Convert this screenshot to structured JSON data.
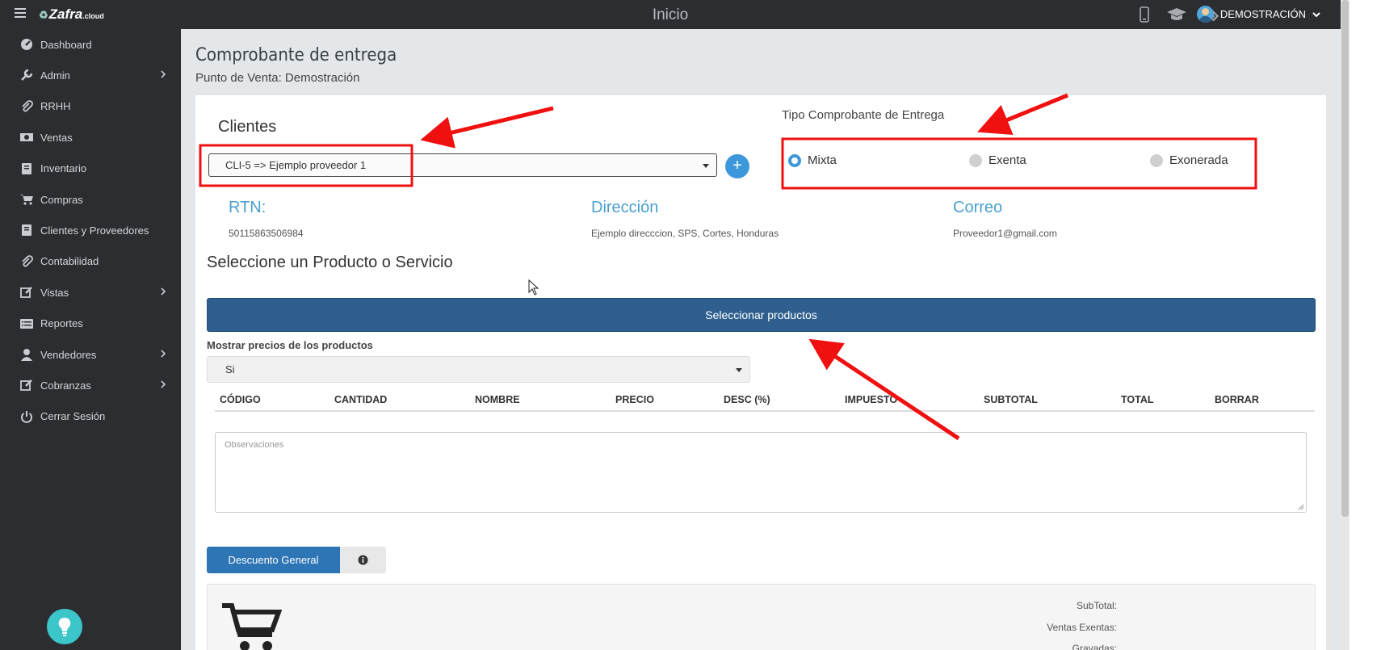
{
  "header": {
    "logo": "Zafra",
    "logo_suffix": ".cloud",
    "title": "Inicio",
    "icons": [
      "mobile-icon",
      "graduation-cap-icon",
      "tags-icon"
    ],
    "user_name": "DEMOSTRACIÓN"
  },
  "sidebar": {
    "items": [
      {
        "label": "Dashboard",
        "icon": "dashboard-icon",
        "has_submenu": false
      },
      {
        "label": "Admin",
        "icon": "wrench-icon",
        "has_submenu": true
      },
      {
        "label": "RRHH",
        "icon": "paperclip-icon",
        "has_submenu": false
      },
      {
        "label": "Ventas",
        "icon": "money-icon",
        "has_submenu": false
      },
      {
        "label": "Inventario",
        "icon": "book-icon",
        "has_submenu": false
      },
      {
        "label": "Compras",
        "icon": "cart-icon",
        "has_submenu": false
      },
      {
        "label": "Clientes y Proveedores",
        "icon": "book-icon",
        "has_submenu": false
      },
      {
        "label": "Contabilidad",
        "icon": "paperclip-icon",
        "has_submenu": false
      },
      {
        "label": "Vistas",
        "icon": "edit-icon",
        "has_submenu": true
      },
      {
        "label": "Reportes",
        "icon": "list-icon",
        "has_submenu": false
      },
      {
        "label": "Vendedores",
        "icon": "user-icon",
        "has_submenu": true
      },
      {
        "label": "Cobranzas",
        "icon": "edit-icon",
        "has_submenu": true
      },
      {
        "label": "Cerrar Sesión",
        "icon": "power-icon",
        "has_submenu": false
      }
    ]
  },
  "page": {
    "title": "Comprobante de entrega",
    "subtitle": "Punto de Venta: Demostración"
  },
  "form": {
    "clientes_label": "Clientes",
    "client_value": "CLI-5 => Ejemplo proveedor 1",
    "add_label": "+",
    "tipo_label": "Tipo Comprobante de Entrega",
    "tipo_options": [
      "Mixta",
      "Exenta",
      "Exonerada"
    ],
    "tipo_selected": "Mixta",
    "rtn_label": "RTN:",
    "rtn_value": "50115863506984",
    "direccion_label": "Dirección",
    "direccion_value": "Ejemplo direcccion, SPS, Cortes, Honduras",
    "correo_label": "Correo",
    "correo_value": "Proveedor1@gmail.com",
    "producto_label": "Seleccione un Producto o Servicio",
    "select_products_label": "Seleccionar productos",
    "precios_label": "Mostrar precios de los productos",
    "precios_value": "Si",
    "table_headers": [
      "CÓDIGO",
      "CANTIDAD",
      "NOMBRE",
      "PRECIO",
      "DESC (%)",
      "IMPUESTO",
      "SUBTOTAL",
      "TOTAL",
      "BORRAR"
    ],
    "observaciones_placeholder": "Observaciones",
    "descuento_label": "Descuento General",
    "summary_labels": [
      "SubTotal:",
      "Ventas Exentas:",
      "Gravadas:"
    ]
  },
  "colors": {
    "annotation": "#f01010",
    "primary": "#2e5f8f",
    "accent": "#3c98db",
    "sidebar_bg": "#2b2d30"
  }
}
